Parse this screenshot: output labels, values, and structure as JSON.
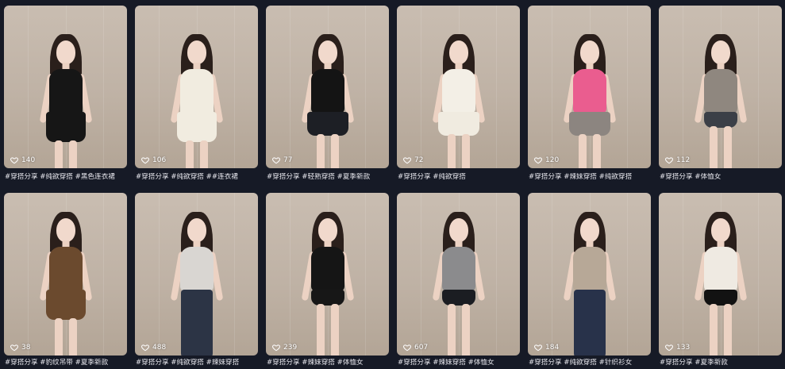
{
  "cards": [
    {
      "likes": "140",
      "caption": "#穿搭分享 #纯欲穿搭 #黑色连衣裙",
      "top": "#161616",
      "bottom": "#1b1b1b",
      "style": "dress"
    },
    {
      "likes": "106",
      "caption": "#穿搭分享 #纯欲穿搭 ##连衣裙",
      "top": "#f1ece0",
      "bottom": "#ece6d8",
      "style": "dress"
    },
    {
      "likes": "77",
      "caption": "#穿搭分享 #轻熟穿搭 #夏季新款",
      "top": "#141414",
      "bottom": "#1d1f25",
      "style": "skirt"
    },
    {
      "likes": "72",
      "caption": "#穿搭分享 #纯欲穿搭",
      "top": "#f3efe6",
      "bottom": "#f0ebe0",
      "style": "skirt"
    },
    {
      "likes": "120",
      "caption": "#穿搭分享 #辣妹穿搭 #纯欲穿搭",
      "top": "#ea5d8f",
      "bottom": "#8c8580",
      "style": "skirt"
    },
    {
      "likes": "112",
      "caption": "#穿搭分享 #体恤女",
      "top": "#8f877f",
      "bottom": "#3b3f47",
      "style": "shorts"
    },
    {
      "likes": "38",
      "caption": "#穿搭分享 #豹纹吊带 #夏季新款",
      "top": "#6b4a2e",
      "bottom": "#5e3f27",
      "style": "dress"
    },
    {
      "likes": "488",
      "caption": "#穿搭分享 #纯欲穿搭 #辣妹穿搭",
      "top": "#d9d6d2",
      "bottom": "#2c3445",
      "style": "pants"
    },
    {
      "likes": "239",
      "caption": "#穿搭分享 #辣妹穿搭 #体恤女",
      "top": "#151515",
      "bottom": "#171717",
      "style": "shorts"
    },
    {
      "likes": "607",
      "caption": "#穿搭分享 #辣妹穿搭 #体恤女",
      "top": "#8b8b8d",
      "bottom": "#1b1d22",
      "style": "shorts"
    },
    {
      "likes": "184",
      "caption": "#穿搭分享 #纯欲穿搭 #针织衫女",
      "top": "#b7a897",
      "bottom": "#28324a",
      "style": "pants"
    },
    {
      "likes": "133",
      "caption": "#穿搭分享 #夏季新款",
      "top": "#efeae2",
      "bottom": "#121212",
      "style": "shorts"
    }
  ]
}
